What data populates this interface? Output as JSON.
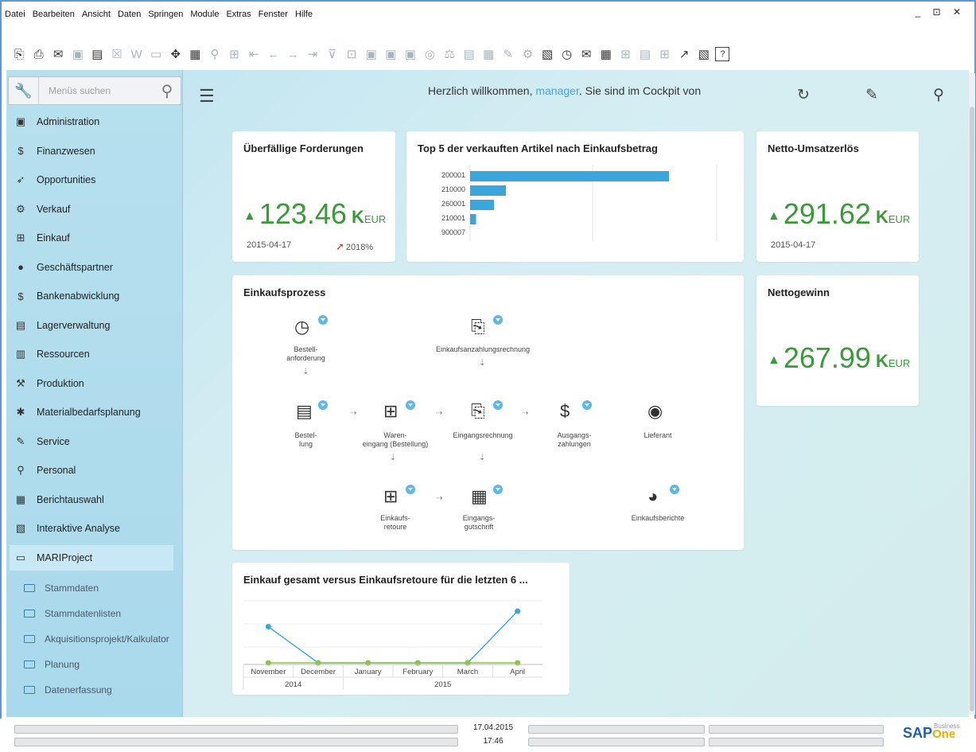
{
  "menu": [
    "Datei",
    "Bearbeiten",
    "Ansicht",
    "Daten",
    "Springen",
    "Module",
    "Extras",
    "Fenster",
    "Hilfe"
  ],
  "window_controls": "_ ⊡ ✕",
  "search": {
    "placeholder": "Menüs suchen"
  },
  "sidebar": {
    "items": [
      {
        "label": "Administration",
        "icon": "admin-icon",
        "glyph": "▣"
      },
      {
        "label": "Finanzwesen",
        "icon": "finance-icon",
        "glyph": "$"
      },
      {
        "label": "Opportunities",
        "icon": "opportunities-icon",
        "glyph": "➶"
      },
      {
        "label": "Verkauf",
        "icon": "sales-icon",
        "glyph": "⚙"
      },
      {
        "label": "Einkauf",
        "icon": "purchase-cart-icon",
        "glyph": "⊞"
      },
      {
        "label": "Geschäftspartner",
        "icon": "partner-person-icon",
        "glyph": "●"
      },
      {
        "label": "Bankenabwicklung",
        "icon": "bank-dollar-icon",
        "glyph": "$"
      },
      {
        "label": "Lagerverwaltung",
        "icon": "warehouse-icon",
        "glyph": "▤"
      },
      {
        "label": "Ressourcen",
        "icon": "resources-icon",
        "glyph": "▥"
      },
      {
        "label": "Produktion",
        "icon": "production-icon",
        "glyph": "⚒"
      },
      {
        "label": "Materialbedarfsplanung",
        "icon": "mrp-puzzle-icon",
        "glyph": "✱"
      },
      {
        "label": "Service",
        "icon": "service-icon",
        "glyph": "✎"
      },
      {
        "label": "Personal",
        "icon": "personnel-icon",
        "glyph": "⚲"
      },
      {
        "label": "Berichtauswahl",
        "icon": "reports-icon",
        "glyph": "▦"
      },
      {
        "label": "Interaktive Analyse",
        "icon": "analysis-icon",
        "glyph": "▧"
      },
      {
        "label": "MARIProject",
        "icon": "folder-icon",
        "glyph": "▭"
      }
    ],
    "subitems": [
      "Stammdaten",
      "Stammdatenlisten",
      "Akquisitionsprojekt/Kalkulator",
      "Planung",
      "Datenerfassung"
    ]
  },
  "header": {
    "welcome_prefix": "Herzlich willkommen, ",
    "user": "manager",
    "welcome_suffix": ". Sie sind im Cockpit von"
  },
  "cards": {
    "overdue": {
      "title": "Überfällige Forderungen",
      "value": "123.46",
      "unit_k": "K",
      "unit": "EUR",
      "date": "2015-04-17",
      "pct": "2018%"
    },
    "top5": {
      "title": "Top 5 der verkauften Artikel nach Einkaufsbetrag"
    },
    "netsales": {
      "title": "Netto-Umsatzerlös",
      "value": "291.62",
      "unit_k": "K",
      "unit": "EUR",
      "date": "2015-04-17"
    },
    "netprofit": {
      "title": "Nettogewinn",
      "value": "267.99",
      "unit_k": "K",
      "unit": "EUR"
    },
    "process": {
      "title": "Einkaufsprozess",
      "nodes": {
        "req": "Bestell-\nanforderung",
        "downpay": "Einkaufsanzahlungsrechnung",
        "order": "Bestel-\nlung",
        "goods": "Waren-\neingang (Bestellung)",
        "invoice": "Eingangsrechnung",
        "outpay": "Ausgangs-\nzahlungen",
        "vendor": "Lieferant",
        "returns": "Einkaufs-\nretoure",
        "credit": "Eingangs-\ngutschrift",
        "reports": "Einkaufsberichte"
      }
    },
    "trend": {
      "title": "Einkauf gesamt versus Einkaufsretoure für die letzten 6 ..."
    }
  },
  "chart_data": [
    {
      "type": "bar",
      "orientation": "horizontal",
      "categories": [
        "200001",
        "210000",
        "260001",
        "210001",
        "900007"
      ],
      "values": [
        100,
        18,
        12,
        3,
        0
      ],
      "title": "Top 5 der verkauften Artikel nach Einkaufsbetrag",
      "color": "#3aa6dc",
      "grid": true
    },
    {
      "type": "line",
      "title": "Einkauf gesamt versus Einkaufsretoure für die letzten 6 ...",
      "categories": [
        "November",
        "December",
        "January",
        "February",
        "March",
        "April"
      ],
      "year_groups": [
        {
          "label": "2014",
          "span": 2
        },
        {
          "label": "2015",
          "span": 4
        }
      ],
      "series": [
        {
          "values": [
            3.5,
            0,
            0,
            0,
            0,
            5
          ],
          "color": "#3aa6dc"
        },
        {
          "values": [
            0,
            0,
            0,
            0,
            0,
            0
          ],
          "color": "#8cc63f"
        }
      ],
      "ylim": [
        0,
        6
      ],
      "grid": true
    }
  ],
  "status": {
    "date": "17.04.2015",
    "time": "17:46",
    "brand": "SAP",
    "brand_one": "One",
    "brand_business": "Business"
  }
}
